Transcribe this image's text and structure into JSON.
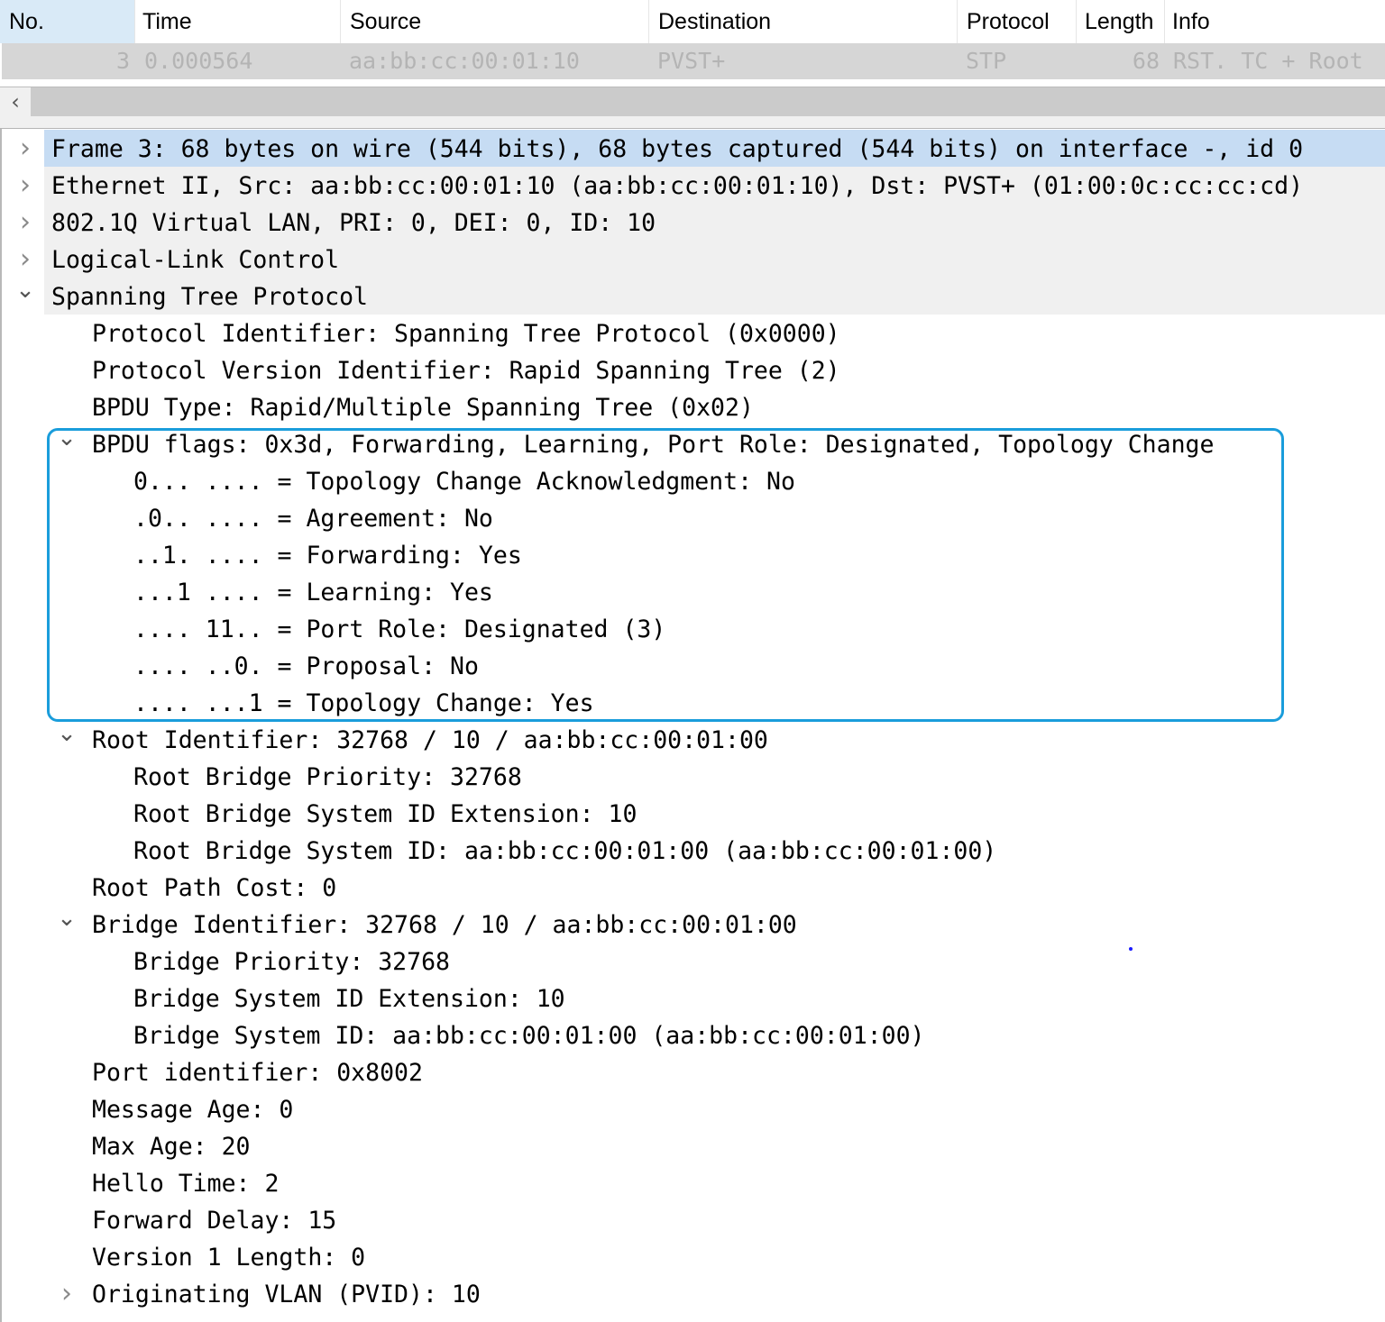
{
  "packet_list": {
    "columns": [
      {
        "key": "no",
        "label": "No.",
        "sorted": true
      },
      {
        "key": "time",
        "label": "Time"
      },
      {
        "key": "source",
        "label": "Source"
      },
      {
        "key": "destination",
        "label": "Destination"
      },
      {
        "key": "protocol",
        "label": "Protocol"
      },
      {
        "key": "length",
        "label": "Length"
      },
      {
        "key": "info",
        "label": "Info"
      }
    ],
    "rows": [
      {
        "no": "3",
        "time": "0.000564",
        "source": "aa:bb:cc:00:01:10",
        "destination": "PVST+",
        "protocol": "STP",
        "length": "68",
        "info": "RST. TC + Root"
      }
    ],
    "scroll_left_icon": "chevron-left"
  },
  "details": {
    "rows": [
      {
        "level": 0,
        "toggle": "collapsed",
        "selected": true,
        "text": "Frame 3: 68 bytes on wire (544 bits), 68 bytes captured (544 bits) on interface -, id 0"
      },
      {
        "level": 0,
        "toggle": "collapsed",
        "text": "Ethernet II, Src: aa:bb:cc:00:01:10 (aa:bb:cc:00:01:10), Dst: PVST+ (01:00:0c:cc:cc:cd)"
      },
      {
        "level": 0,
        "toggle": "collapsed",
        "text": "802.1Q Virtual LAN, PRI: 0, DEI: 0, ID: 10"
      },
      {
        "level": 0,
        "toggle": "collapsed",
        "text": "Logical-Link Control"
      },
      {
        "level": 0,
        "toggle": "expanded",
        "text": "Spanning Tree Protocol"
      },
      {
        "level": 1,
        "toggle": "none",
        "text": "Protocol Identifier: Spanning Tree Protocol (0x0000)"
      },
      {
        "level": 1,
        "toggle": "none",
        "text": "Protocol Version Identifier: Rapid Spanning Tree (2)"
      },
      {
        "level": 1,
        "toggle": "none",
        "text": "BPDU Type: Rapid/Multiple Spanning Tree (0x02)"
      },
      {
        "level": 1,
        "toggle": "expanded",
        "text": "BPDU flags: 0x3d, Forwarding, Learning, Port Role: Designated, Topology Change"
      },
      {
        "level": 2,
        "toggle": "none",
        "text": "0... .... = Topology Change Acknowledgment: No"
      },
      {
        "level": 2,
        "toggle": "none",
        "text": ".0.. .... = Agreement: No"
      },
      {
        "level": 2,
        "toggle": "none",
        "text": "..1. .... = Forwarding: Yes"
      },
      {
        "level": 2,
        "toggle": "none",
        "text": "...1 .... = Learning: Yes"
      },
      {
        "level": 2,
        "toggle": "none",
        "text": ".... 11.. = Port Role: Designated (3)"
      },
      {
        "level": 2,
        "toggle": "none",
        "text": ".... ..0. = Proposal: No"
      },
      {
        "level": 2,
        "toggle": "none",
        "text": ".... ...1 = Topology Change: Yes"
      },
      {
        "level": 1,
        "toggle": "expanded",
        "text": "Root Identifier: 32768 / 10 / aa:bb:cc:00:01:00"
      },
      {
        "level": 2,
        "toggle": "none",
        "text": "Root Bridge Priority: 32768"
      },
      {
        "level": 2,
        "toggle": "none",
        "text": "Root Bridge System ID Extension: 10"
      },
      {
        "level": 2,
        "toggle": "none",
        "text": "Root Bridge System ID: aa:bb:cc:00:01:00 (aa:bb:cc:00:01:00)"
      },
      {
        "level": 1,
        "toggle": "none",
        "text": "Root Path Cost: 0"
      },
      {
        "level": 1,
        "toggle": "expanded",
        "text": "Bridge Identifier: 32768 / 10 / aa:bb:cc:00:01:00"
      },
      {
        "level": 2,
        "toggle": "none",
        "text": "Bridge Priority: 32768"
      },
      {
        "level": 2,
        "toggle": "none",
        "text": "Bridge System ID Extension: 10"
      },
      {
        "level": 2,
        "toggle": "none",
        "text": "Bridge System ID: aa:bb:cc:00:01:00 (aa:bb:cc:00:01:00)"
      },
      {
        "level": 1,
        "toggle": "none",
        "text": "Port identifier: 0x8002"
      },
      {
        "level": 1,
        "toggle": "none",
        "text": "Message Age: 0"
      },
      {
        "level": 1,
        "toggle": "none",
        "text": "Max Age: 20"
      },
      {
        "level": 1,
        "toggle": "none",
        "text": "Hello Time: 2"
      },
      {
        "level": 1,
        "toggle": "none",
        "text": "Forward Delay: 15"
      },
      {
        "level": 1,
        "toggle": "none",
        "text": "Version 1 Length: 0"
      },
      {
        "level": 1,
        "toggle": "collapsed",
        "text": "Originating VLAN (PVID): 10"
      }
    ],
    "highlighted_group": "BPDU flags",
    "icons": {
      "collapsed": "chevron-right",
      "expanded": "chevron-down"
    }
  },
  "colors": {
    "selected_row": "#c6dcf3",
    "sorted_column": "#d9eaf7",
    "highlight_border": "#1a9ddb",
    "packet_row_bg": "#d6d6d6",
    "packet_row_text": "#b4b4b4"
  }
}
